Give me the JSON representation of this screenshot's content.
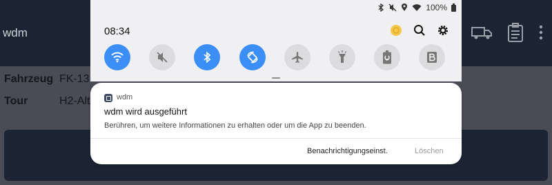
{
  "app": {
    "title": "wdm",
    "fields": [
      {
        "label": "Fahrzeug",
        "value": "FK-13"
      },
      {
        "label": "Tour",
        "value": "H2-Alt"
      }
    ]
  },
  "status_bar": {
    "icons": [
      "bluetooth-icon",
      "mute-icon",
      "location-icon",
      "wifi-icon"
    ],
    "battery": "100%"
  },
  "shade": {
    "time": "08:34",
    "tiles": [
      {
        "name": "wifi",
        "on": true
      },
      {
        "name": "sound-off",
        "on": false
      },
      {
        "name": "bluetooth",
        "on": true
      },
      {
        "name": "auto-rotate",
        "on": true
      },
      {
        "name": "airplane",
        "on": false
      },
      {
        "name": "flashlight",
        "on": false
      },
      {
        "name": "battery-saver",
        "on": false
      },
      {
        "name": "blue-light",
        "on": false
      }
    ]
  },
  "notification": {
    "app_name": "wdm",
    "title": "wdm wird ausgeführt",
    "text": "Berühren, um weitere Informationen zu erhalten oder um die App zu beenden.",
    "action_settings": "Benachrichtigungseinst.",
    "action_clear": "Löschen"
  },
  "colors": {
    "accent": "#3b8ef5",
    "tile_off": "#dcdcde",
    "app_header": "#1c2433"
  }
}
